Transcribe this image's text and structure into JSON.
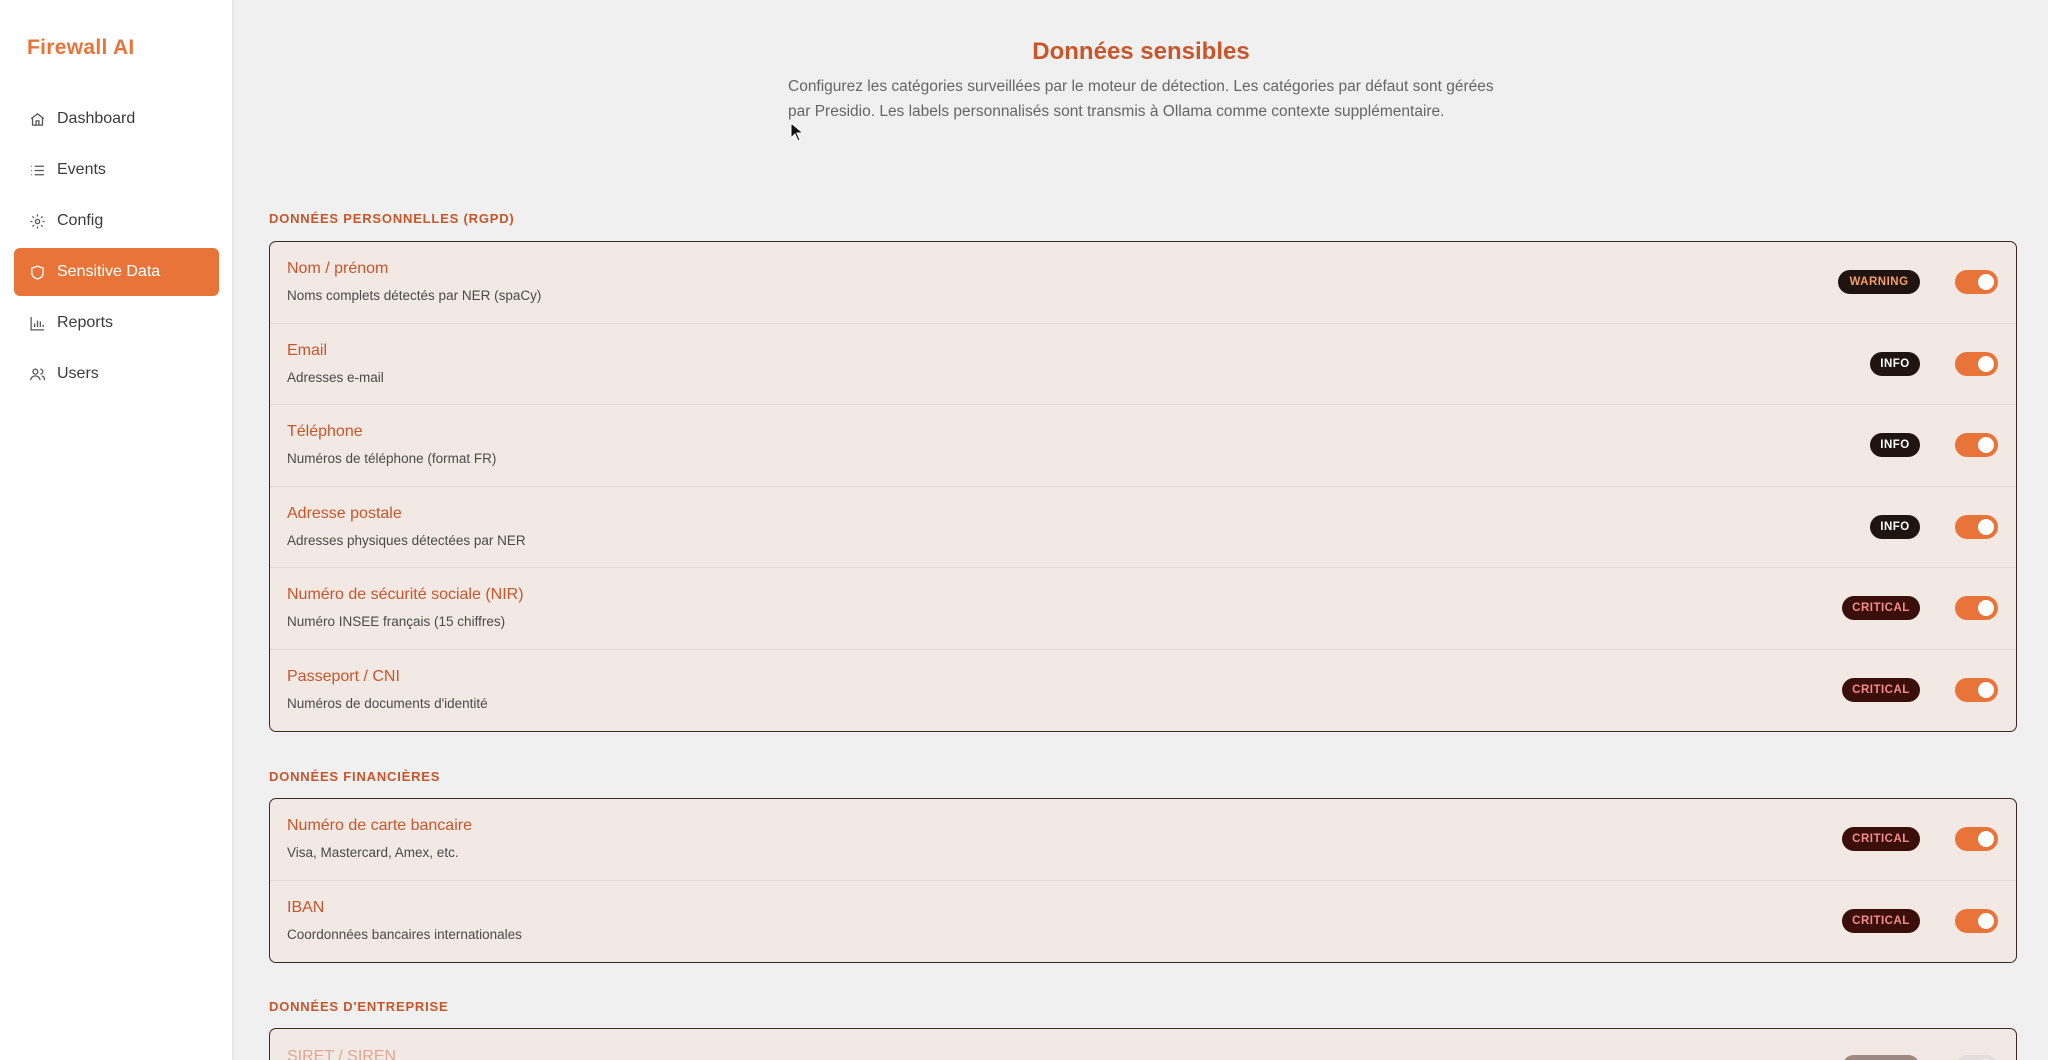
{
  "app": {
    "brand": "Firewall AI"
  },
  "sidebar": {
    "items": [
      {
        "label": "Dashboard",
        "icon": "home-icon",
        "active": false
      },
      {
        "label": "Events",
        "icon": "list-icon",
        "active": false
      },
      {
        "label": "Config",
        "icon": "gear-icon",
        "active": false
      },
      {
        "label": "Sensitive Data",
        "icon": "shield-icon",
        "active": true
      },
      {
        "label": "Reports",
        "icon": "bar-chart-icon",
        "active": false
      },
      {
        "label": "Users",
        "icon": "users-icon",
        "active": false
      }
    ]
  },
  "page": {
    "title": "Données sensibles",
    "description": "Configurez les catégories surveillées par le moteur de détection. Les catégories par défaut sont gérées par Presidio. Les labels personnalisés sont transmis à Ollama comme contexte supplémentaire."
  },
  "sections": [
    {
      "title": "DONNÉES PERSONNELLES (RGPD)",
      "rows": [
        {
          "name": "Nom / prénom",
          "desc": "Noms complets détectés par NER (spaCy)",
          "badge": "WARNING",
          "level": "warning",
          "enabled": true
        },
        {
          "name": "Email",
          "desc": "Adresses e-mail",
          "badge": "INFO",
          "level": "info",
          "enabled": true
        },
        {
          "name": "Téléphone",
          "desc": "Numéros de téléphone (format FR)",
          "badge": "INFO",
          "level": "info",
          "enabled": true
        },
        {
          "name": "Adresse postale",
          "desc": "Adresses physiques détectées par NER",
          "badge": "INFO",
          "level": "info",
          "enabled": true
        },
        {
          "name": "Numéro de sécurité sociale (NIR)",
          "desc": "Numéro INSEE français (15 chiffres)",
          "badge": "CRITICAL",
          "level": "critical",
          "enabled": true
        },
        {
          "name": "Passeport / CNI",
          "desc": "Numéros de documents d'identité",
          "badge": "CRITICAL",
          "level": "critical",
          "enabled": true
        }
      ]
    },
    {
      "title": "DONNÉES FINANCIÈRES",
      "rows": [
        {
          "name": "Numéro de carte bancaire",
          "desc": "Visa, Mastercard, Amex, etc.",
          "badge": "CRITICAL",
          "level": "critical",
          "enabled": true
        },
        {
          "name": "IBAN",
          "desc": "Coordonnées bancaires internationales",
          "badge": "CRITICAL",
          "level": "critical",
          "enabled": true
        }
      ]
    },
    {
      "title": "DONNÉES D'ENTREPRISE",
      "rows": [
        {
          "name": "SIRET / SIREN",
          "desc": "",
          "badge": "",
          "level": "critical",
          "enabled": true
        }
      ]
    }
  ],
  "colors": {
    "accent": "#e8743a",
    "title": "#c9552a",
    "badge_dark": "#1f1410"
  }
}
